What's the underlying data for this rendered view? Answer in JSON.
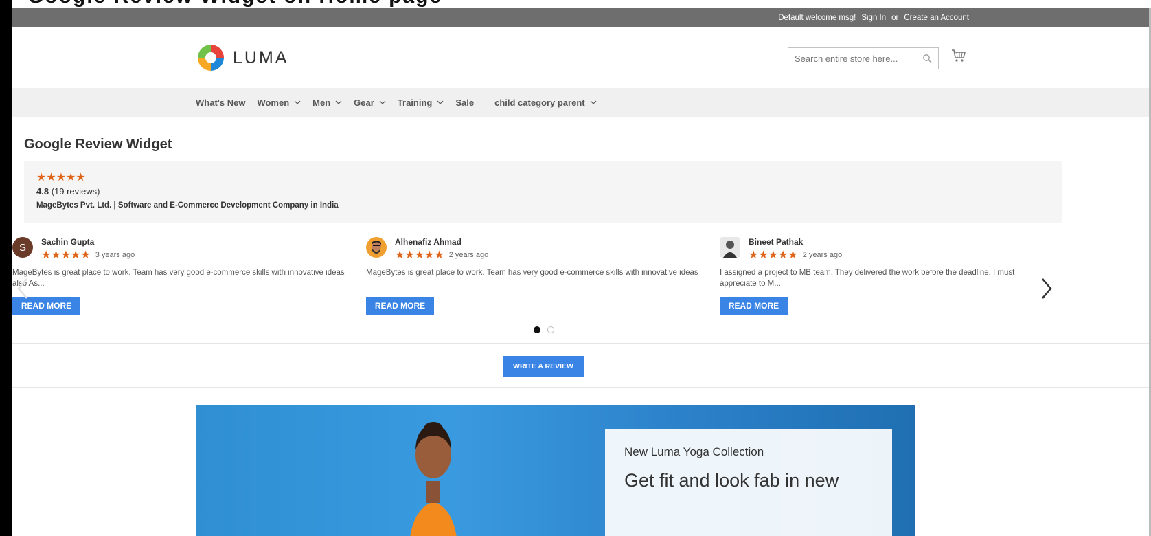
{
  "caption": "Google Review Widget on Home page",
  "topbar": {
    "welcome": "Default welcome msg!",
    "sign_in": "Sign In",
    "or": "or",
    "create_account": "Create an Account"
  },
  "header": {
    "logo_text": "LUMA",
    "search_placeholder": "Search entire store here..."
  },
  "nav": {
    "items": [
      {
        "label": "What's New",
        "dropdown": false
      },
      {
        "label": "Women",
        "dropdown": true
      },
      {
        "label": "Men",
        "dropdown": true
      },
      {
        "label": "Gear",
        "dropdown": true
      },
      {
        "label": "Training",
        "dropdown": true
      },
      {
        "label": "Sale",
        "dropdown": false
      },
      {
        "label": "child category parent",
        "dropdown": true
      }
    ]
  },
  "widget": {
    "title": "Google Review Widget",
    "stars": "★★★★★",
    "rating": "4.8",
    "review_count": "(19 reviews)",
    "company": "MageBytes Pvt. Ltd. | Software and E-Commerce Development Company in India"
  },
  "reviews": [
    {
      "name": "Sachin Gupta",
      "avatar_letter": "S",
      "stars": "★★★★★",
      "ago": "3 years ago",
      "text": "MageBytes is great place to work. Team has very good e-commerce skills with innovative ideas also As...",
      "button": "READ MORE"
    },
    {
      "name": "Alhenafiz Ahmad",
      "stars": "★★★★★",
      "ago": "2 years ago",
      "text": "MageBytes is great place to work. Team has very good e-commerce skills with innovative ideas",
      "button": "READ MORE"
    },
    {
      "name": "Bineet Pathak",
      "stars": "★★★★★",
      "ago": "2 years ago",
      "text": "I assigned a project to MB team. They delivered the work before the deadline. I must appreciate to M...",
      "button": "READ MORE"
    }
  ],
  "write_review": "WRITE A REVIEW",
  "hero": {
    "kicker": "New Luma Yoga Collection",
    "headline": "Get fit and look fab in new"
  },
  "colors": {
    "topbar": "#6e6e6e",
    "nav_bg": "#f0f0f0",
    "star": "#e06417",
    "button": "#3a84e6"
  }
}
